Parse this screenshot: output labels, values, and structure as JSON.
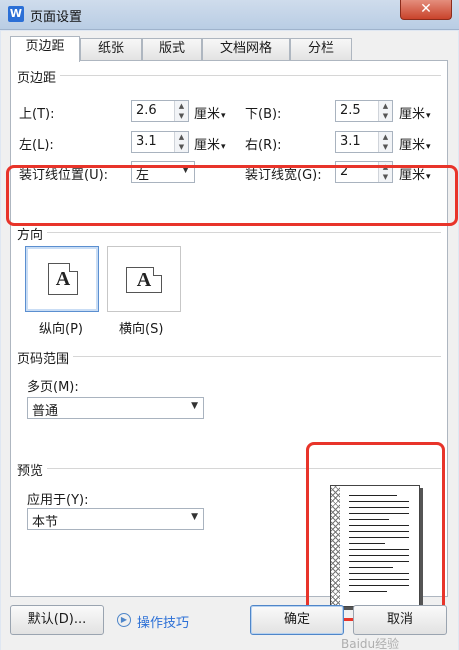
{
  "window": {
    "title": "页面设置",
    "close_glyph": "✕",
    "app_icon_letter": "W"
  },
  "tabs": [
    "页边距",
    "纸张",
    "版式",
    "文档网格",
    "分栏"
  ],
  "margins": {
    "group_title": "页边距",
    "top": {
      "label": "上(T):",
      "value": "2.6",
      "unit": "厘米"
    },
    "bottom": {
      "label": "下(B):",
      "value": "2.5",
      "unit": "厘米"
    },
    "left": {
      "label": "左(L):",
      "value": "3.1",
      "unit": "厘米"
    },
    "right": {
      "label": "右(R):",
      "value": "3.1",
      "unit": "厘米"
    },
    "gutter_pos": {
      "label": "装订线位置(U):",
      "value": "左"
    },
    "gutter_width": {
      "label": "装订线宽(G):",
      "value": "2",
      "unit": "厘米"
    }
  },
  "orientation": {
    "group_title": "方向",
    "portrait": "纵向(P)",
    "landscape": "横向(S)",
    "glyph": "A",
    "selected": "portrait"
  },
  "page_range": {
    "group_title": "页码范围",
    "multi_label": "多页(M):",
    "multi_value": "普通"
  },
  "preview": {
    "group_title": "预览",
    "apply_label": "应用于(Y):",
    "apply_value": "本节"
  },
  "buttons": {
    "default": "默认(D)...",
    "tips": "操作技巧",
    "ok": "确定",
    "cancel": "取消"
  },
  "watermark": "Baidu经验",
  "colors": {
    "highlight": "#e8342a",
    "accent": "#2b6fd6"
  }
}
